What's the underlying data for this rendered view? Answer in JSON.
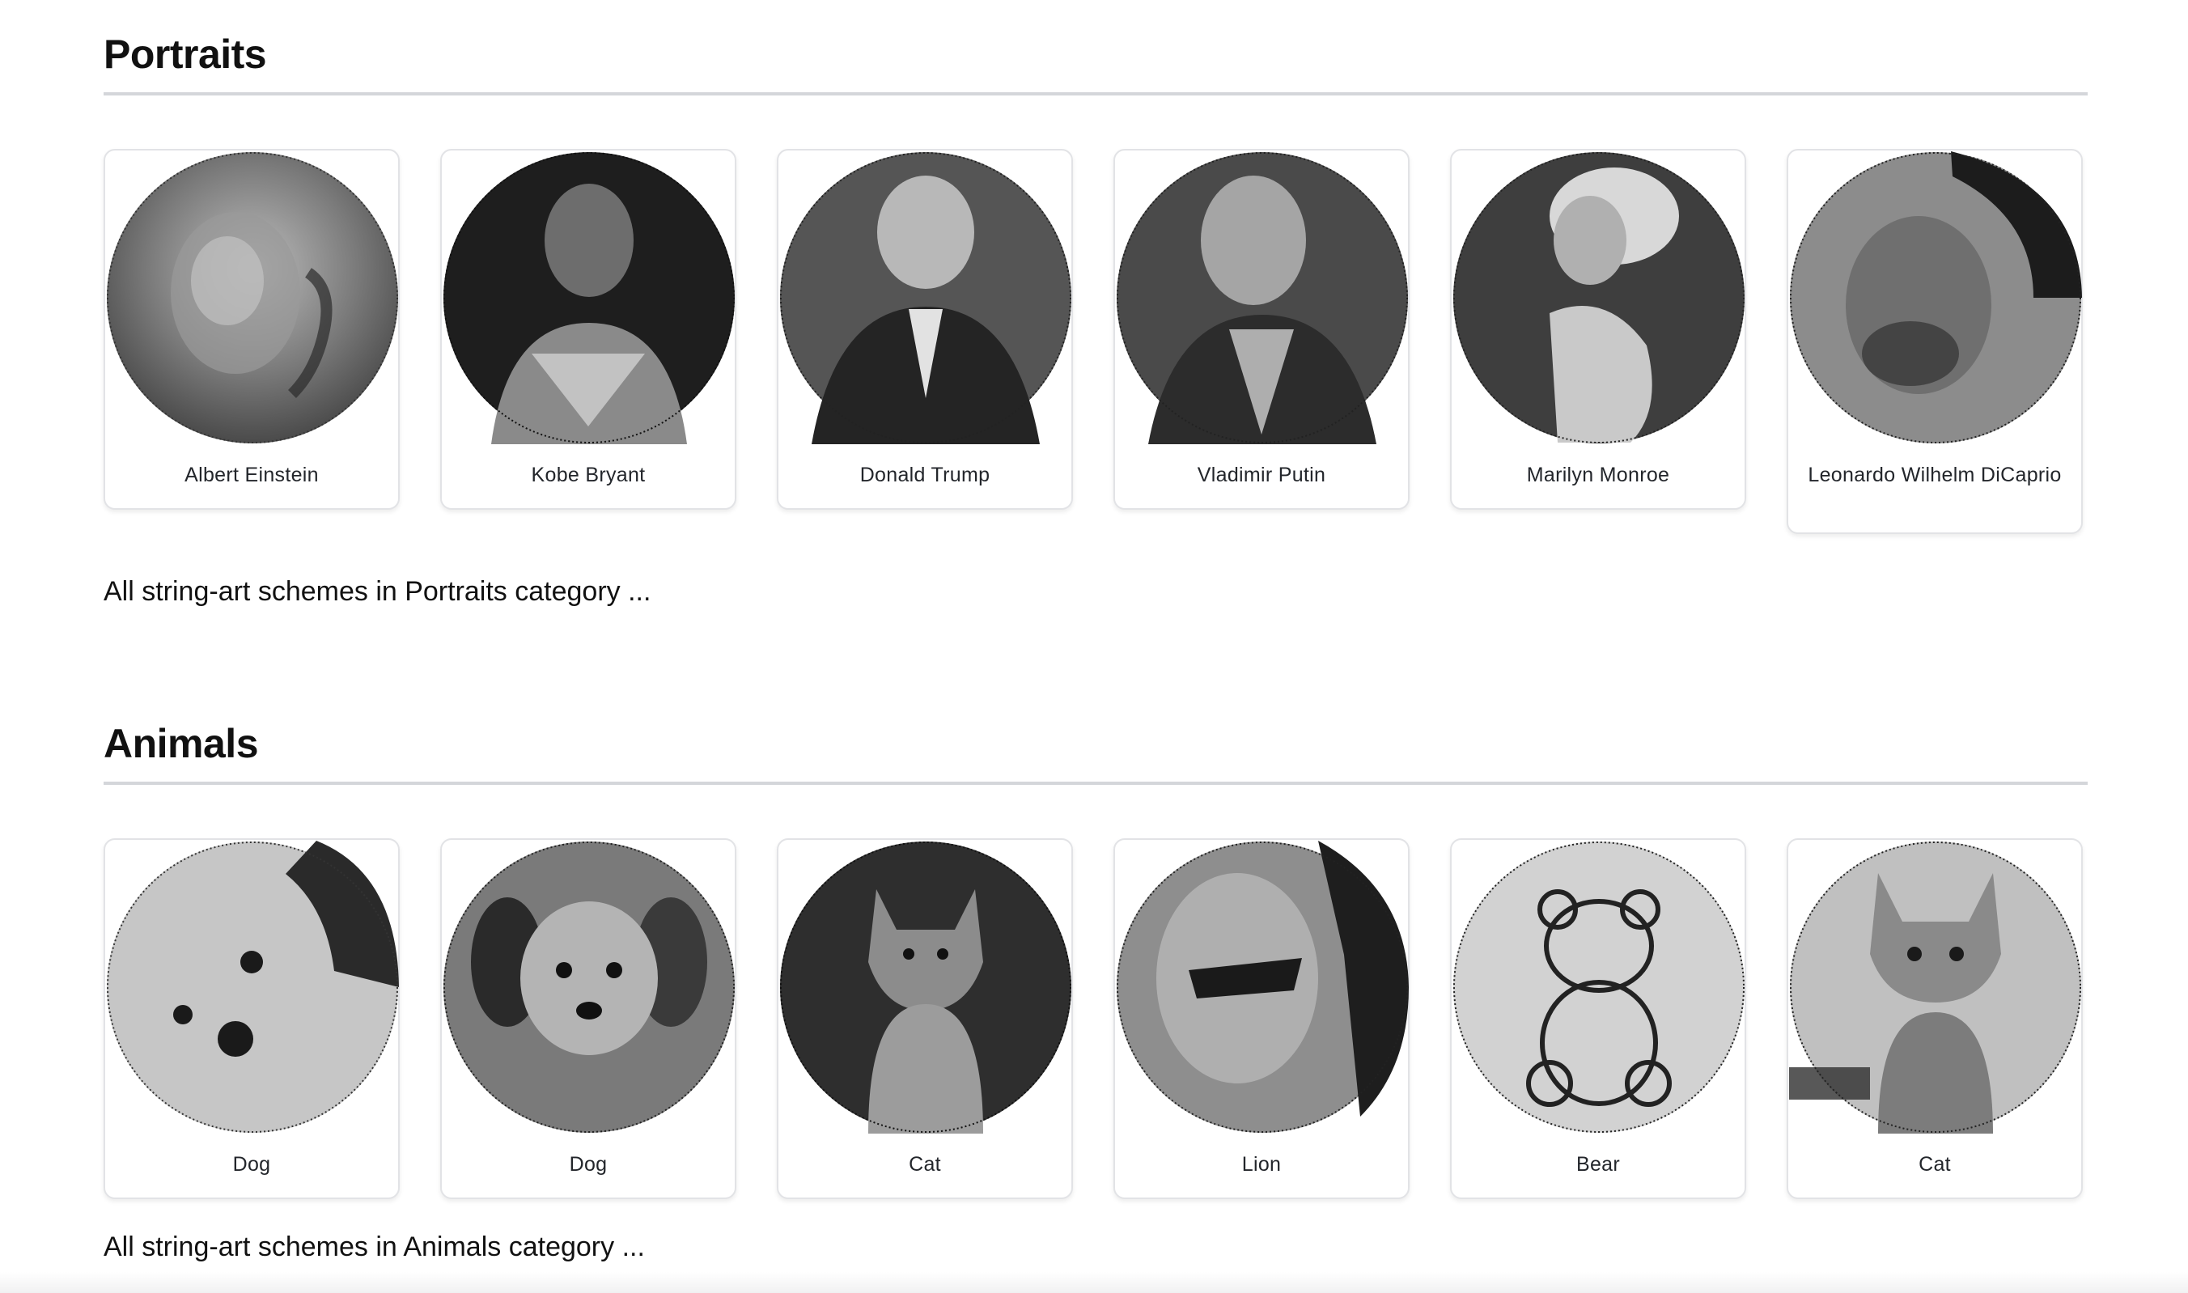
{
  "sections": [
    {
      "title": "Portraits",
      "see_all": "All string-art schemes in Portraits category ...",
      "items": [
        {
          "label": "Albert Einstein",
          "icon": "string-art-portrait-icon",
          "tone": "#8a8a8a"
        },
        {
          "label": "Kobe Bryant",
          "icon": "string-art-portrait-icon",
          "tone": "#3a3a3a"
        },
        {
          "label": "Donald Trump",
          "icon": "string-art-portrait-icon",
          "tone": "#5c5c5c"
        },
        {
          "label": "Vladimir Putin",
          "icon": "string-art-portrait-icon",
          "tone": "#6a6a6a"
        },
        {
          "label": "Marilyn Monroe",
          "icon": "string-art-portrait-icon",
          "tone": "#555555"
        },
        {
          "label": "Leonardo Wilhelm DiCaprio",
          "icon": "string-art-portrait-icon",
          "tone": "#7a7a7a"
        }
      ]
    },
    {
      "title": "Animals",
      "see_all": "All string-art schemes in Animals category ...",
      "items": [
        {
          "label": "Dog",
          "icon": "string-art-animal-icon",
          "tone": "#b5b5b5"
        },
        {
          "label": "Dog",
          "icon": "string-art-animal-icon",
          "tone": "#6e6e6e"
        },
        {
          "label": "Cat",
          "icon": "string-art-animal-icon",
          "tone": "#5a5a5a"
        },
        {
          "label": "Lion",
          "icon": "string-art-animal-icon",
          "tone": "#7c7c7c"
        },
        {
          "label": "Bear",
          "icon": "string-art-animal-icon",
          "tone": "#c4c4c4"
        },
        {
          "label": "Cat",
          "icon": "string-art-animal-icon",
          "tone": "#a8a8a8"
        }
      ]
    }
  ]
}
